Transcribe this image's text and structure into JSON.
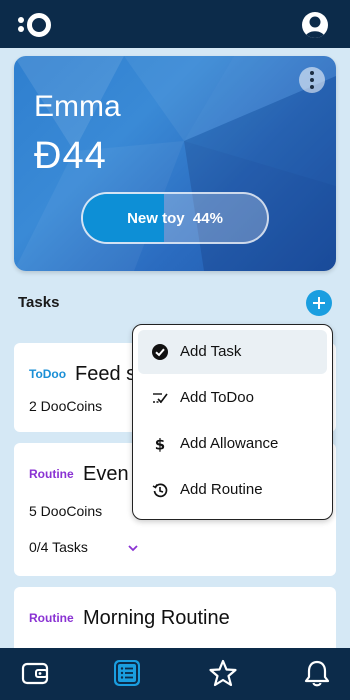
{
  "hero": {
    "name": "Emma",
    "balance": "Ɖ44",
    "goal": {
      "label": "New toy  44%",
      "progress": 0.44
    }
  },
  "tasks": {
    "title": "Tasks",
    "cards": [
      {
        "type": "ToDoo",
        "title": "Feed s",
        "coins": "2 DooCoins"
      },
      {
        "type": "Routine",
        "title": "Even",
        "coins": "5 DooCoins",
        "subtasks": "0/4 Tasks"
      },
      {
        "type": "Routine",
        "title": "Morning Routine"
      }
    ]
  },
  "menu": {
    "items": [
      {
        "label": "Add Task",
        "icon": "check-circle-icon"
      },
      {
        "label": "Add ToDoo",
        "icon": "checklist-icon"
      },
      {
        "label": "Add Allowance",
        "icon": "dollar-icon"
      },
      {
        "label": "Add Routine",
        "icon": "routine-icon"
      }
    ]
  },
  "nav": {
    "items": [
      "wallet-icon",
      "list-icon",
      "star-icon",
      "bell-icon"
    ],
    "active": "list-icon"
  },
  "colors": {
    "topbar": "#0c2b4a",
    "accent": "#1a9ee0",
    "todo": "#1a8fd6",
    "routine": "#8a32d3"
  }
}
